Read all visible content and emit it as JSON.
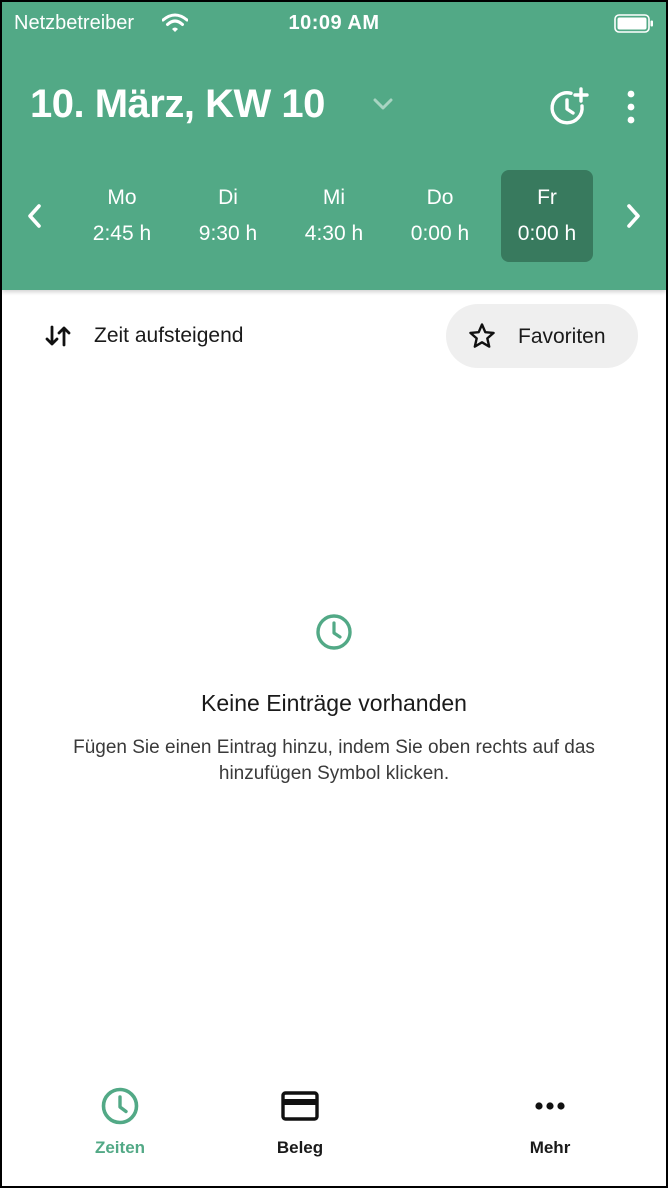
{
  "status_bar": {
    "carrier": "Netzbetreiber",
    "time": "10:09 AM"
  },
  "header": {
    "title": "10. März, KW 10",
    "icons": {
      "title_dropdown": "chevron-down-icon",
      "add_time": "clock-plus-icon",
      "more": "more-vertical-icon",
      "prev": "chevron-left-icon",
      "next": "chevron-right-icon"
    },
    "days": [
      {
        "name": "Mo",
        "hours": "2:45 h",
        "selected": false
      },
      {
        "name": "Di",
        "hours": "9:30 h",
        "selected": false
      },
      {
        "name": "Mi",
        "hours": "4:30 h",
        "selected": false
      },
      {
        "name": "Do",
        "hours": "0:00 h",
        "selected": false
      },
      {
        "name": "Fr",
        "hours": "0:00 h",
        "selected": true
      }
    ]
  },
  "toolbar": {
    "sort_label": "Zeit aufsteigend",
    "favorites_label": "Favoriten"
  },
  "empty_state": {
    "title": "Keine Einträge vorhanden",
    "text": "Fügen Sie einen Eintrag hinzu, indem Sie oben rechts auf das hinzufügen Symbol klicken."
  },
  "tabbar": {
    "items": [
      {
        "label": "Zeiten",
        "icon": "clock-icon",
        "active": true
      },
      {
        "label": "Beleg",
        "icon": "credit-card-icon",
        "active": false
      },
      {
        "label": "Mehr",
        "icon": "more-horizontal-icon",
        "active": false
      }
    ]
  },
  "colors": {
    "brand": "#52a986",
    "selected_day": "#387a5e",
    "chip_background": "#efefef"
  }
}
